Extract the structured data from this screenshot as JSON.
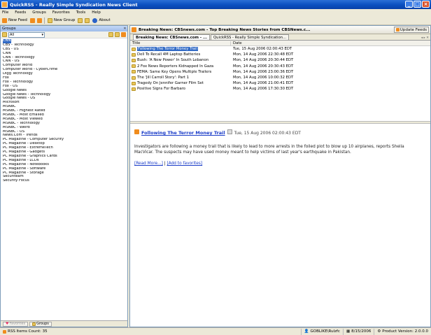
{
  "window": {
    "title": "QuickRSS - Really Simple Syndication News Client"
  },
  "menu": [
    "File",
    "Feeds",
    "Groups",
    "Favorites",
    "Tools",
    "Help"
  ],
  "toolbar": {
    "new_feed": "New Feed",
    "new_group": "New Group",
    "about": "About"
  },
  "left_panel": {
    "header": "Groups",
    "filter_value": "All",
    "feeds": [
      "CNN",
      "CBS - Technology",
      "CBS - US",
      "CNN",
      "CNN - Technology",
      "CNN - US",
      "Computer World",
      "Computer World - CyberCrime",
      "Digg Technology",
      "Fox",
      "Fox - Technology",
      "Fox - US",
      "Google News",
      "Google News - Technology",
      "Google News - US",
      "Microsoft",
      "MSNBC",
      "MSNBC - Highest Rated",
      "MSNBC - Most Emailed",
      "MSNBC - Most Viewed",
      "MSNBC - Technology",
      "MSNBC - Weird",
      "MSNBC - US",
      "News.Com - Trends",
      "PC Magazine - Computer Security",
      "PC Magazine - Desktop",
      "PC Magazine - ExtremeTech",
      "PC Magazine - Gadgets",
      "PC Magazine - Graphics Cards",
      "PC Magazine - LCDs",
      "PC Magazine - Notebooks",
      "PC Magazine - Software",
      "PC Magazine - Storage",
      "Securiteam",
      "Security Focus"
    ],
    "tabs": [
      "Favorites",
      "Groups"
    ]
  },
  "right_panel": {
    "header": "Breaking News: CBSnews.com - Top Breaking News Stories from CBSNews.c...",
    "update_button": "Update Feeds",
    "tabs": [
      "Breaking News: CBSnews.com - ...",
      "QuickRSS - Really Simple Syndication..."
    ],
    "columns": {
      "title": "Title",
      "date": "Date"
    },
    "items": [
      {
        "title": "Following The Terror Money Trail",
        "date": "Tue, 15 Aug 2006 02:00:43 EDT"
      },
      {
        "title": "Dell To Recall 4M Laptop Batteries",
        "date": "Mon, 14 Aug 2006 22:30:48 EDT"
      },
      {
        "title": "Bush: 'A New Power' In South Lebanon",
        "date": "Mon, 14 Aug 2006 20:30:44 EDT"
      },
      {
        "title": "2 Fox News Reporters Kidnapped In Gaza",
        "date": "Mon, 14 Aug 2006 20:30:43 EDT"
      },
      {
        "title": "FEMA: Same Key Opens Multiple Trailers",
        "date": "Mon, 14 Aug 2006 23:00:36 EDT"
      },
      {
        "title": "The 'Jill Carroll Story': Part 1",
        "date": "Mon, 14 Aug 2006 10:00:32 EDT"
      },
      {
        "title": "Tragedy On Jennifer Garner Film Set",
        "date": "Mon, 14 Aug 2006 21:00:41 EDT"
      },
      {
        "title": "Positive Signs For Barbaro",
        "date": "Mon, 14 Aug 2006 17:30:30 EDT"
      }
    ],
    "preview": {
      "title": "Following The Terror Money Trail",
      "date": "Tue, 15 Aug 2006 02:00:43 EDT",
      "body": "Investigators are following a money trail that is likely to lead to more arrests in the foiled plot to blow up 10 airplanes, reports Sheila MacVicar. The suspects may have used money meant to help victims of last year's earthquake in Pakistan.",
      "read_more": "[Read More...]",
      "divider": "|",
      "add_favorites": "[Add to favorites]"
    }
  },
  "status": {
    "items_count": "RSS Items Count: 35",
    "user": "GOBLIKE\\Rulzfc",
    "date": "8/15/2006",
    "version": "Product Version: 2.0.0.0"
  }
}
